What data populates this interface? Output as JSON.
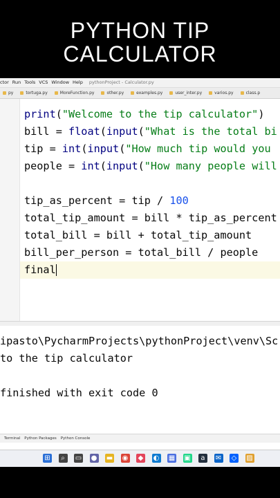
{
  "banner": {
    "line1": "PYTHON TIP",
    "line2": "CALCULATOR"
  },
  "menubar": {
    "items": [
      "ctor",
      "Run",
      "Tools",
      "VCS",
      "Window",
      "Help"
    ],
    "title": "pythonProject - Calculator.py"
  },
  "tabs": [
    "py",
    "tortuga.py",
    "MoreFunction.py",
    "other.py",
    "examples.py",
    "user_inter.py",
    "varios.py",
    "class.p"
  ],
  "editor": {
    "lines": [
      [
        {
          "t": "print",
          "c": "fn"
        },
        {
          "t": "(",
          "c": ""
        },
        {
          "t": "\"Welcome to the tip calculator\"",
          "c": "str"
        },
        {
          "t": ")",
          "c": ""
        }
      ],
      [
        {
          "t": "bill = ",
          "c": ""
        },
        {
          "t": "float",
          "c": "fn"
        },
        {
          "t": "(",
          "c": ""
        },
        {
          "t": "input",
          "c": "fn"
        },
        {
          "t": "(",
          "c": ""
        },
        {
          "t": "\"What is the total bi",
          "c": "str"
        }
      ],
      [
        {
          "t": "tip = ",
          "c": ""
        },
        {
          "t": "int",
          "c": "fn"
        },
        {
          "t": "(",
          "c": ""
        },
        {
          "t": "input",
          "c": "fn"
        },
        {
          "t": "(",
          "c": ""
        },
        {
          "t": "\"How much tip would you",
          "c": "str"
        }
      ],
      [
        {
          "t": "people = ",
          "c": ""
        },
        {
          "t": "int",
          "c": "fn"
        },
        {
          "t": "(",
          "c": ""
        },
        {
          "t": "input",
          "c": "fn"
        },
        {
          "t": "(",
          "c": ""
        },
        {
          "t": "\"How many people will",
          "c": "str"
        }
      ],
      [],
      [
        {
          "t": "tip_as_percent = tip / ",
          "c": ""
        },
        {
          "t": "100",
          "c": "num"
        }
      ],
      [
        {
          "t": "total_tip_amount = bill * tip_as_percent",
          "c": ""
        }
      ],
      [
        {
          "t": "total_bill = bill + total_tip_amount",
          "c": ""
        }
      ],
      [
        {
          "t": "bill_per_person = total_bill / people",
          "c": ""
        }
      ],
      [
        {
          "t": "final",
          "c": ""
        }
      ]
    ]
  },
  "console": {
    "lines": [
      "ipasto\\PycharmProjects\\pythonProject\\venv\\Sc",
      "to the tip calculator",
      "",
      "finished with exit code 0"
    ]
  },
  "statusbar": {
    "items": [
      "Terminal",
      "Python Packages",
      "Python Console"
    ]
  },
  "taskbar": {
    "icons": [
      {
        "name": "windows-start-icon",
        "glyph": "⊞",
        "color": "#2a6fd6"
      },
      {
        "name": "search-icon",
        "glyph": "⌕",
        "color": "#444"
      },
      {
        "name": "task-view-icon",
        "glyph": "▭",
        "color": "#444"
      },
      {
        "name": "chat-icon",
        "glyph": "●",
        "color": "#6264a7"
      },
      {
        "name": "explorer-icon",
        "glyph": "▬",
        "color": "#e6b422"
      },
      {
        "name": "chrome-icon",
        "glyph": "◉",
        "color": "#db4437"
      },
      {
        "name": "app-icon",
        "glyph": "◆",
        "color": "#e3455b"
      },
      {
        "name": "edge-icon",
        "glyph": "◐",
        "color": "#0f7bd1"
      },
      {
        "name": "store-icon",
        "glyph": "▦",
        "color": "#4a6ee0"
      },
      {
        "name": "pycharm-icon",
        "glyph": "▣",
        "color": "#21d789"
      },
      {
        "name": "amazon-icon",
        "glyph": "a",
        "color": "#232f3e"
      },
      {
        "name": "mail-icon",
        "glyph": "✉",
        "color": "#0a64c8"
      },
      {
        "name": "dropbox-icon",
        "glyph": "◇",
        "color": "#0061fe"
      },
      {
        "name": "photos-icon",
        "glyph": "▨",
        "color": "#e0a030"
      }
    ]
  }
}
